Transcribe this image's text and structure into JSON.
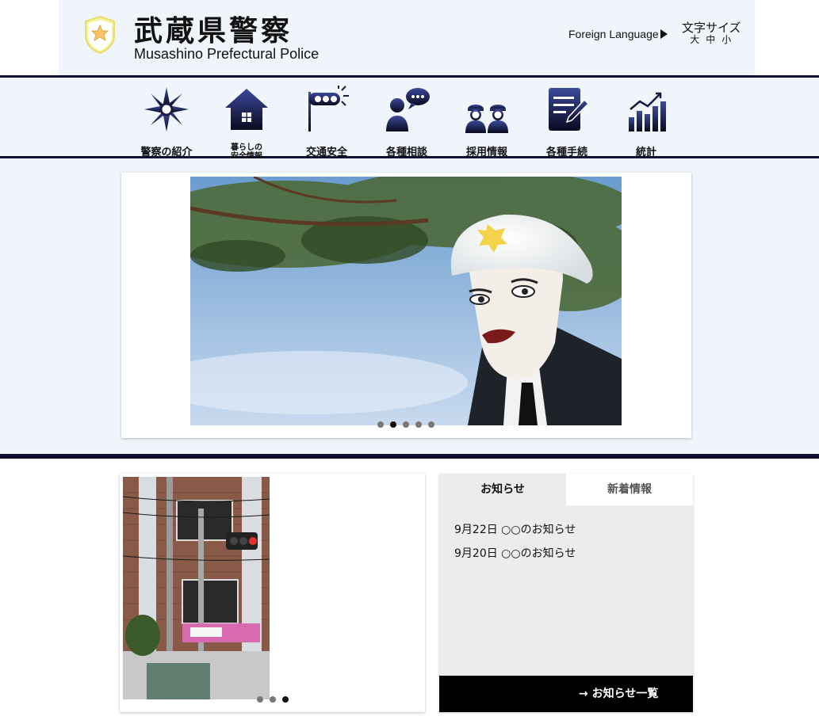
{
  "header": {
    "title": "武蔵県警察",
    "subtitle": "Musashino Prefectural Police",
    "foreign_language": "Foreign Language",
    "font_size": {
      "title": "文字サイズ",
      "options": [
        "大",
        "中",
        "小"
      ]
    }
  },
  "nav": {
    "items": [
      {
        "label": "警察の紹介",
        "icon": "police-emblem-icon"
      },
      {
        "label": "暮らしの\n安全情報",
        "icon": "house-icon"
      },
      {
        "label": "交通安全",
        "icon": "traffic-signal-icon"
      },
      {
        "label": "各種相談",
        "icon": "consultation-icon"
      },
      {
        "label": "採用情報",
        "icon": "officers-icon"
      },
      {
        "label": "各種手続",
        "icon": "document-pen-icon"
      },
      {
        "label": "統計",
        "icon": "bar-chart-icon"
      }
    ]
  },
  "hero": {
    "image": "police-mannequin-photo",
    "slide_count": 5,
    "active_slide": 2
  },
  "photo_slider": {
    "image": "traffic-light-building-photo",
    "slide_count": 3,
    "active_slide": 3
  },
  "news": {
    "tabs": [
      {
        "label": "お知らせ",
        "active": true
      },
      {
        "label": "新着情報",
        "active": false
      }
    ],
    "items": [
      "9月22日 ○○のお知らせ",
      "9月20日 ○○のお知らせ"
    ],
    "more_link": "→ お知らせ一覧"
  },
  "colors": {
    "navy": "#0f0f30",
    "pale_band": "#f0f4fb",
    "icon_gradient_top": "#3a4a9a",
    "icon_gradient_bottom": "#0a0a20",
    "news_bg": "#ecedea"
  }
}
